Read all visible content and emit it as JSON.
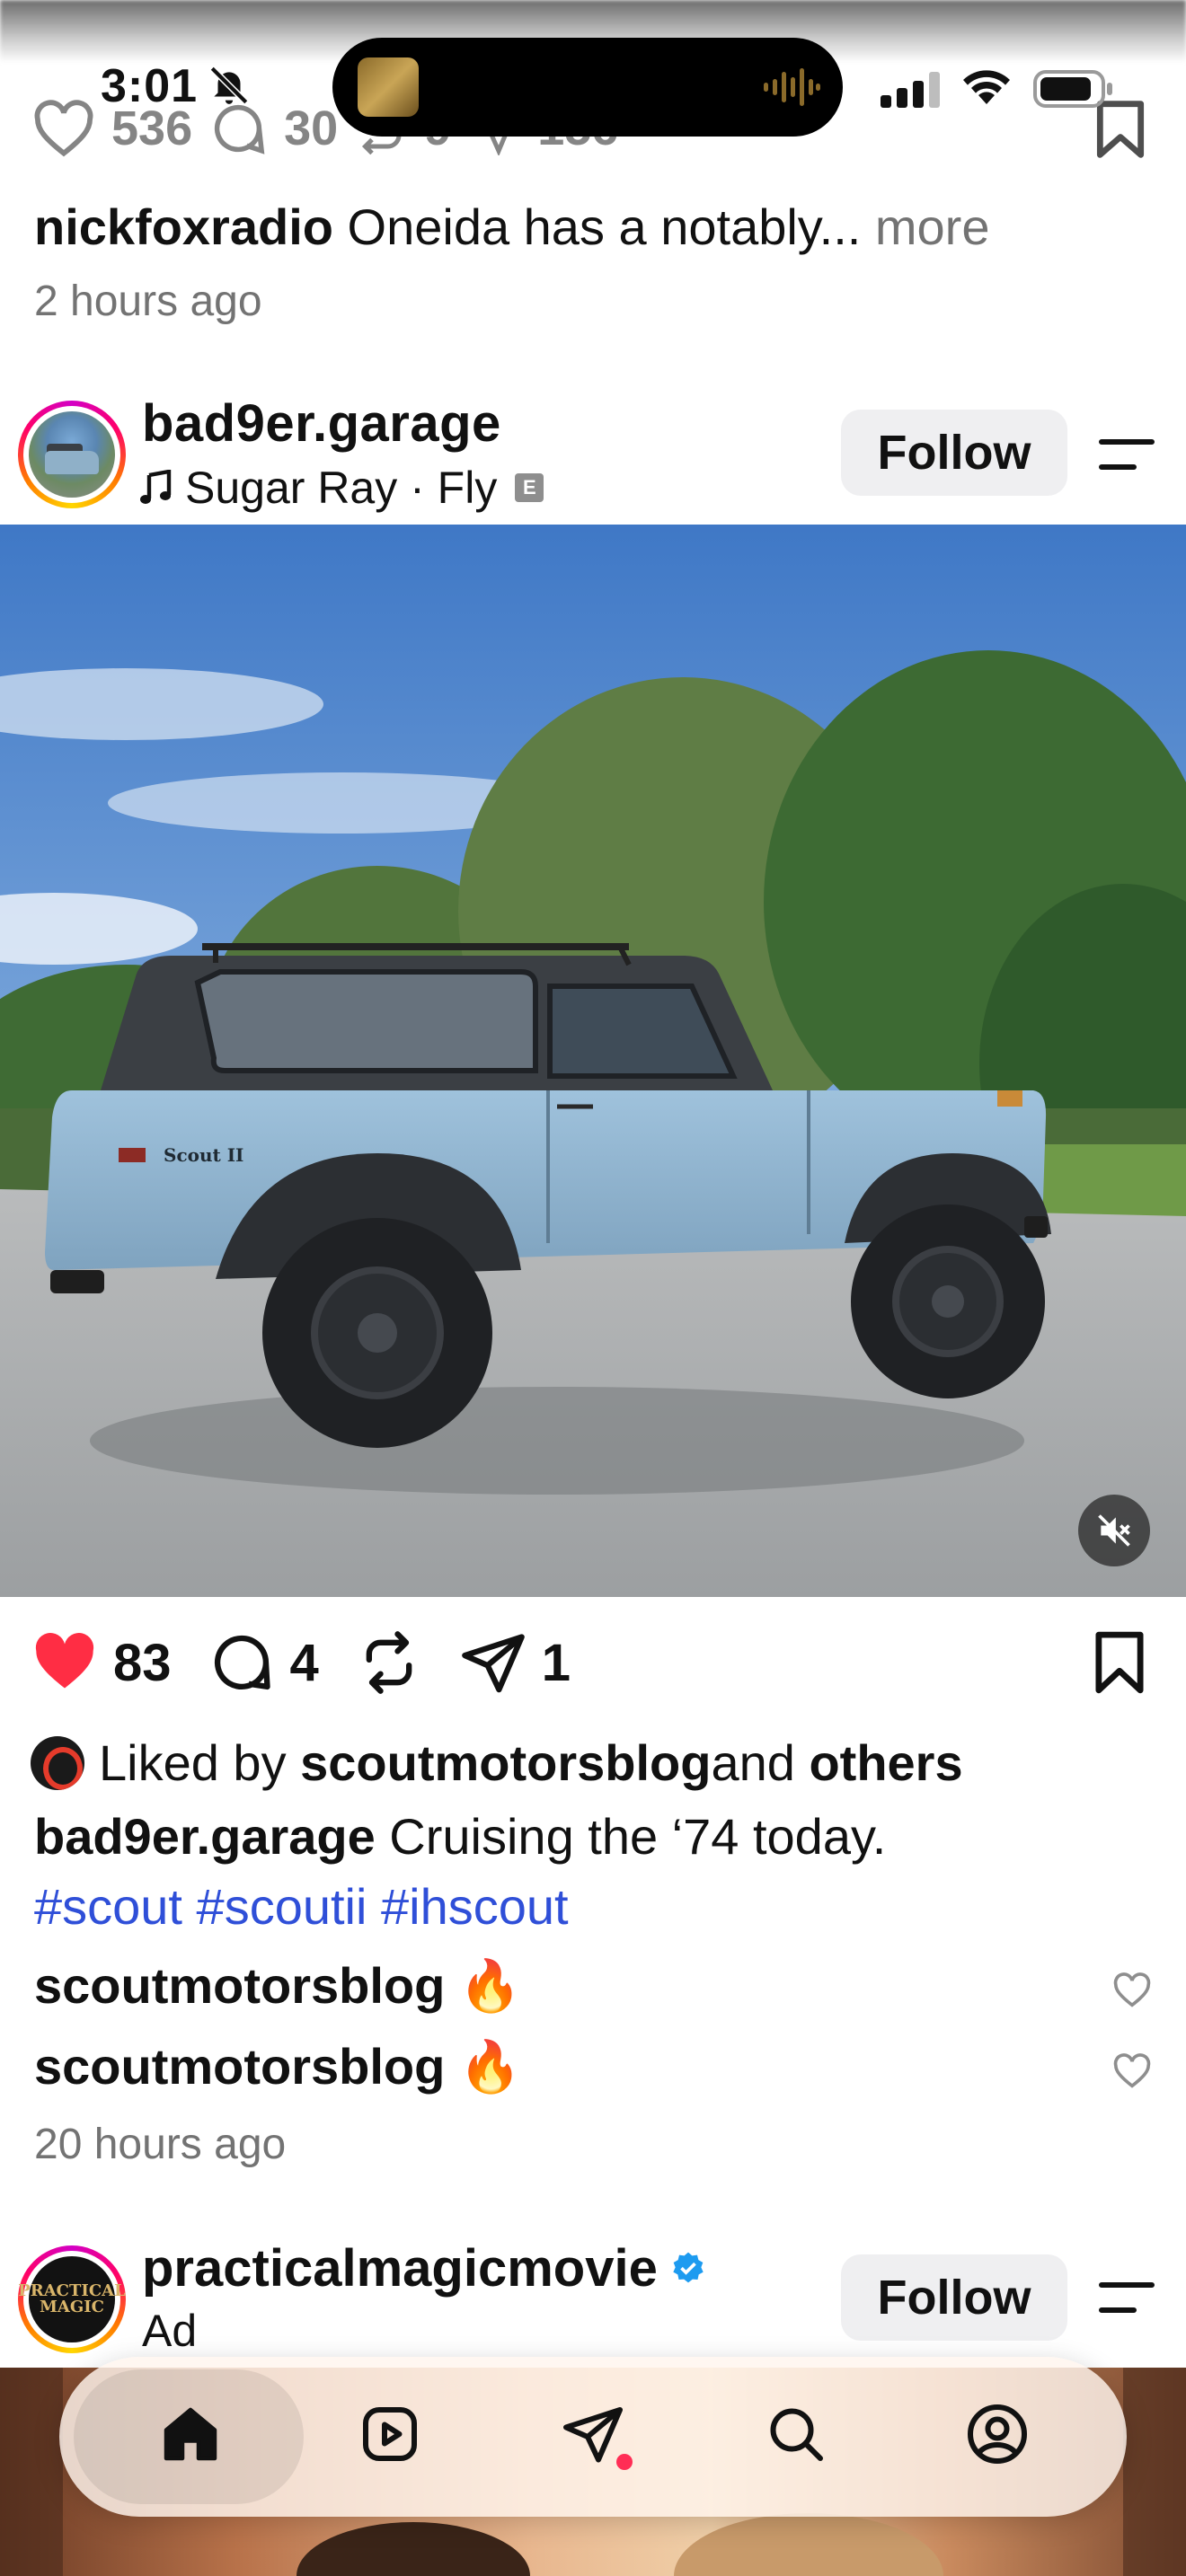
{
  "status_bar": {
    "time": "3:01",
    "silent_mode_icon": "bell-slash-icon",
    "signal_icon": "cellular-signal-icon",
    "wifi_icon": "wifi-icon",
    "battery_icon": "battery-icon"
  },
  "previous_post": {
    "likes": "536",
    "comments": "30",
    "reposts": "9",
    "shares": "156",
    "caption_user": "nickfoxradio",
    "caption_text": " Oneida has a notably...",
    "more_label": " more",
    "timestamp": "2 hours ago"
  },
  "post": {
    "username": "bad9er.garage",
    "music_label": "Sugar Ray · Fly",
    "explicit_badge": "E",
    "follow_label": "Follow",
    "likes": "83",
    "comments": "4",
    "shares": "1",
    "liked_by_prefix": "Liked by ",
    "liked_by_user": "scoutmotorsblog",
    "liked_by_and": " and ",
    "liked_by_others": "others",
    "caption_user": "bad9er.garage",
    "caption_text": " Cruising the ‘74 today.",
    "hashtags": "#scout #scoutii #ihscout",
    "comments_list": [
      {
        "user": "scoutmotorsblog",
        "text": " 🔥"
      },
      {
        "user": "scoutmotorsblog",
        "text": " 🔥"
      }
    ],
    "timestamp": "20 hours ago",
    "vehicle_badge": "Scout II",
    "like_color": "#ff2d44"
  },
  "next_post": {
    "username": "practicalmagicmovie",
    "ad_label": "Ad",
    "follow_label": "Follow",
    "avatar_text": "PRACTICAL MAGIC"
  },
  "tab_bar": {
    "tabs": [
      "home-icon",
      "reels-icon",
      "direct-messages-icon",
      "search-icon",
      "profile-icon"
    ],
    "active": "home-icon",
    "notification_color": "#ff2d55"
  }
}
